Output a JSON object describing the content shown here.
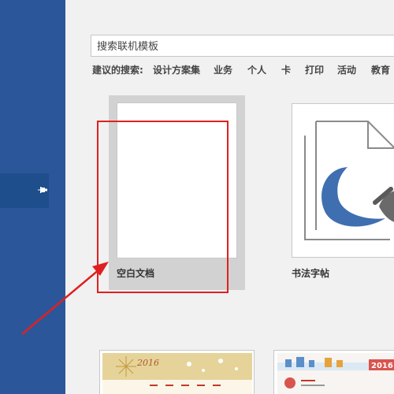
{
  "search": {
    "placeholder": "搜索联机模板"
  },
  "suggested": {
    "label": "建议的搜索:",
    "items": [
      "设计方案集",
      "业务",
      "个人",
      "卡",
      "打印",
      "活动",
      "教育"
    ]
  },
  "templates": [
    {
      "label": "空白文档"
    },
    {
      "label": "书法字帖"
    }
  ],
  "calendars": [
    {
      "year": "2016"
    },
    {
      "year": "2016"
    }
  ],
  "colors": {
    "sidebar": "#2b579a",
    "highlight": "#e02020"
  },
  "icons": {
    "pin": "pin-icon"
  }
}
